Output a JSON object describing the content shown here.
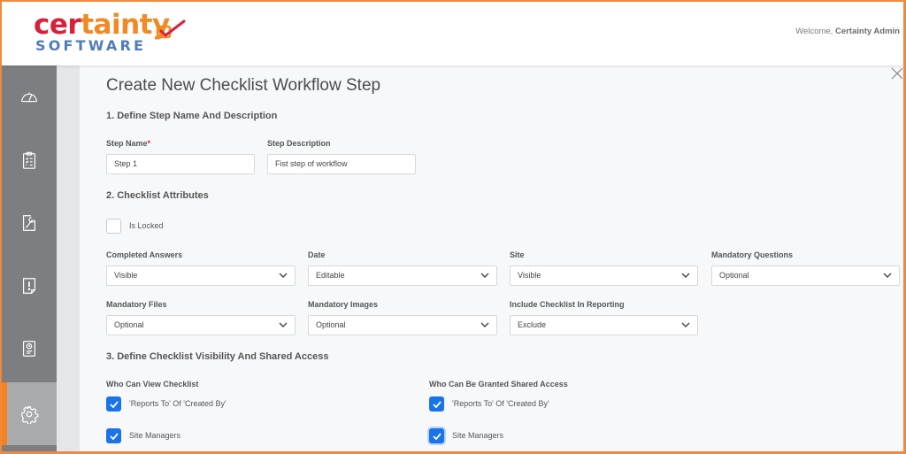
{
  "header": {
    "logo_word_red": "cer",
    "logo_word_orange": "tainty",
    "logo_sub": "SOFTWARE",
    "welcome_prefix": "Welcome, ",
    "welcome_user": "Certainty Admin"
  },
  "sidebar": {
    "items": [
      {
        "name": "dashboard",
        "icon": "speedometer-icon",
        "active": false
      },
      {
        "name": "checklists",
        "icon": "clipboard-checklist-icon",
        "active": false
      },
      {
        "name": "tools",
        "icon": "wrench-document-icon",
        "active": false
      },
      {
        "name": "issues",
        "icon": "alert-document-icon",
        "active": false
      },
      {
        "name": "reports",
        "icon": "clock-document-icon",
        "active": false
      },
      {
        "name": "settings",
        "icon": "gear-icon",
        "active": true
      }
    ]
  },
  "page": {
    "title": "Create New Checklist Workflow Step",
    "close_icon": "close-icon",
    "section1": {
      "heading": "1. Define Step Name And Description",
      "step_name_label": "Step Name",
      "step_name_required": "*",
      "step_name_value": "Step 1",
      "step_description_label": "Step Description",
      "step_description_value": "Fist step of workflow"
    },
    "section2": {
      "heading": "2. Checklist Attributes",
      "is_locked_label": "Is Locked",
      "is_locked": false,
      "fields": [
        {
          "label": "Completed Answers",
          "value": "Visible"
        },
        {
          "label": "Date",
          "value": "Editable"
        },
        {
          "label": "Site",
          "value": "Visible"
        },
        {
          "label": "Mandatory Questions",
          "value": "Optional"
        },
        {
          "label": "Mandatory Files",
          "value": "Optional"
        },
        {
          "label": "Mandatory Images",
          "value": "Optional"
        },
        {
          "label": "Include Checklist In Reporting",
          "value": "Exclude"
        }
      ]
    },
    "section3": {
      "heading": "3. Define Checklist Visibility And Shared Access",
      "view": {
        "heading": "Who Can View Checklist",
        "options": [
          {
            "label": "'Reports To' Of 'Created By'",
            "checked": true
          },
          {
            "label": "Site Managers",
            "checked": true
          }
        ]
      },
      "shared": {
        "heading": "Who Can Be Granted Shared Access",
        "options": [
          {
            "label": "'Reports To' Of 'Created By'",
            "checked": true
          },
          {
            "label": "Site Managers",
            "checked": true
          }
        ]
      }
    }
  },
  "colors": {
    "brand_orange": "#f58220",
    "brand_red": "#d9203a",
    "brand_blue": "#4f7db8",
    "checkbox_blue": "#1a73e8",
    "sidebar_gray": "#7d7e81"
  }
}
